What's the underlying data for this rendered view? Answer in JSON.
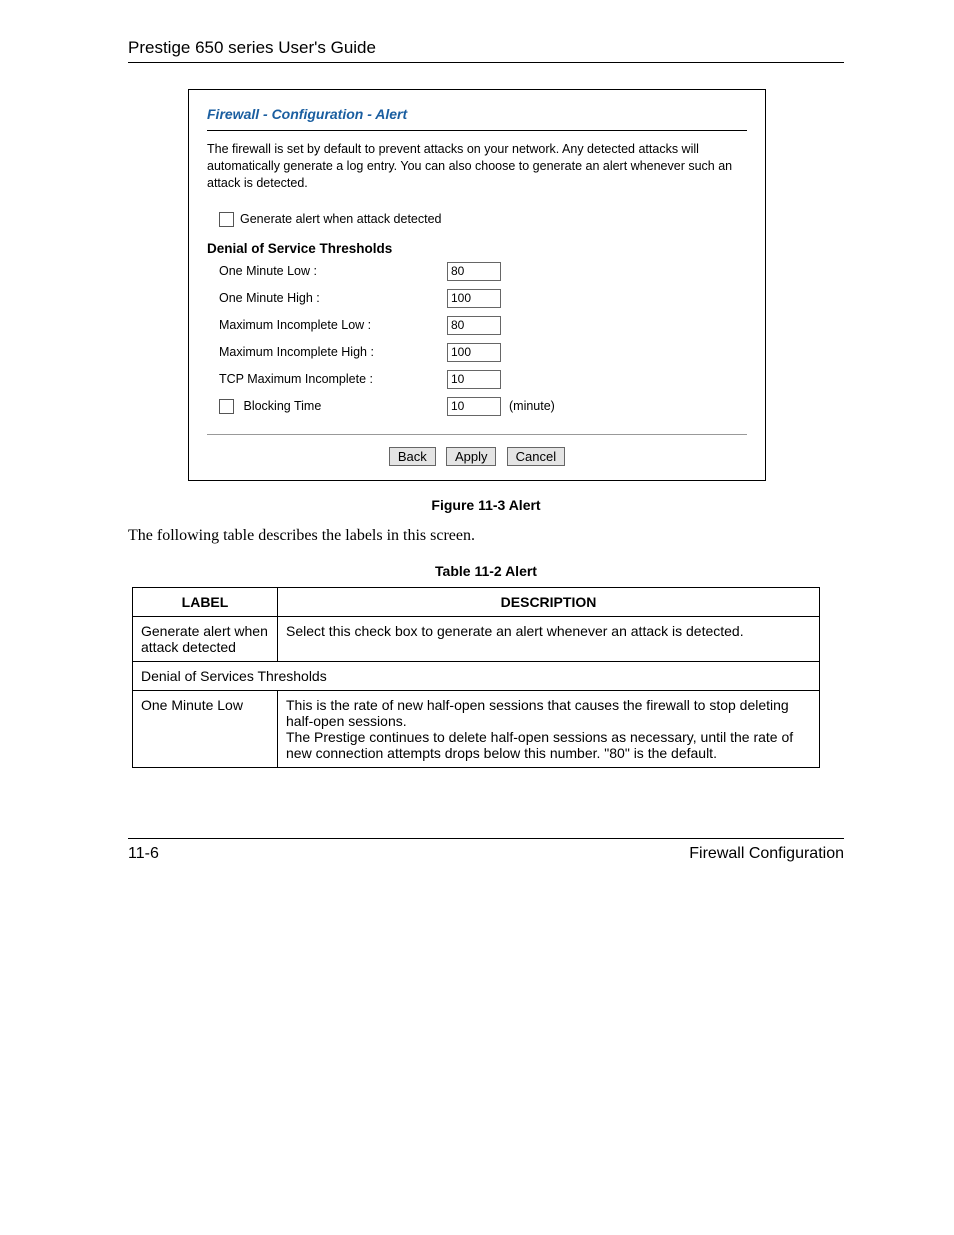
{
  "header": {
    "title": "Prestige 650 series User's Guide"
  },
  "panel": {
    "title": "Firewall - Configuration - Alert",
    "description": "The firewall is set by default to prevent attacks on your network. Any detected attacks will automatically generate a log entry. You can also choose to generate an alert whenever such an attack is detected.",
    "checkbox_generate_alert": "Generate alert when attack detected",
    "section_header": "Denial of Service Thresholds",
    "fields": {
      "one_minute_low": {
        "label": "One Minute Low :",
        "value": "80"
      },
      "one_minute_high": {
        "label": "One Minute High :",
        "value": "100"
      },
      "max_incomplete_low": {
        "label": "Maximum Incomplete Low :",
        "value": "80"
      },
      "max_incomplete_high": {
        "label": "Maximum Incomplete High :",
        "value": "100"
      },
      "tcp_max_incomplete": {
        "label": "TCP Maximum Incomplete :",
        "value": "10"
      },
      "blocking_time": {
        "label": "Blocking Time",
        "value": "10",
        "unit": "(minute)"
      }
    },
    "buttons": {
      "back": "Back",
      "apply": "Apply",
      "cancel": "Cancel"
    }
  },
  "figure_caption": "Figure 11-3 Alert",
  "body_text": "The following table describes the labels in this screen.",
  "table_caption": "Table 11-2 Alert",
  "table": {
    "headers": {
      "label": "LABEL",
      "description": "DESCRIPTION"
    },
    "rows": [
      {
        "label": "Generate alert when attack detected",
        "description": "Select this check box to generate an alert whenever an attack is detected."
      },
      {
        "span_label": "Denial of Services Thresholds"
      },
      {
        "label": "One Minute Low",
        "description": "This is the rate of new half-open sessions that causes the firewall to stop deleting half-open sessions.\nThe Prestige continues to delete half-open sessions as necessary, until the rate of new connection attempts drops below this number. \"80\" is the default."
      }
    ]
  },
  "footer": {
    "left": "11-6",
    "right": "Firewall Configuration"
  }
}
